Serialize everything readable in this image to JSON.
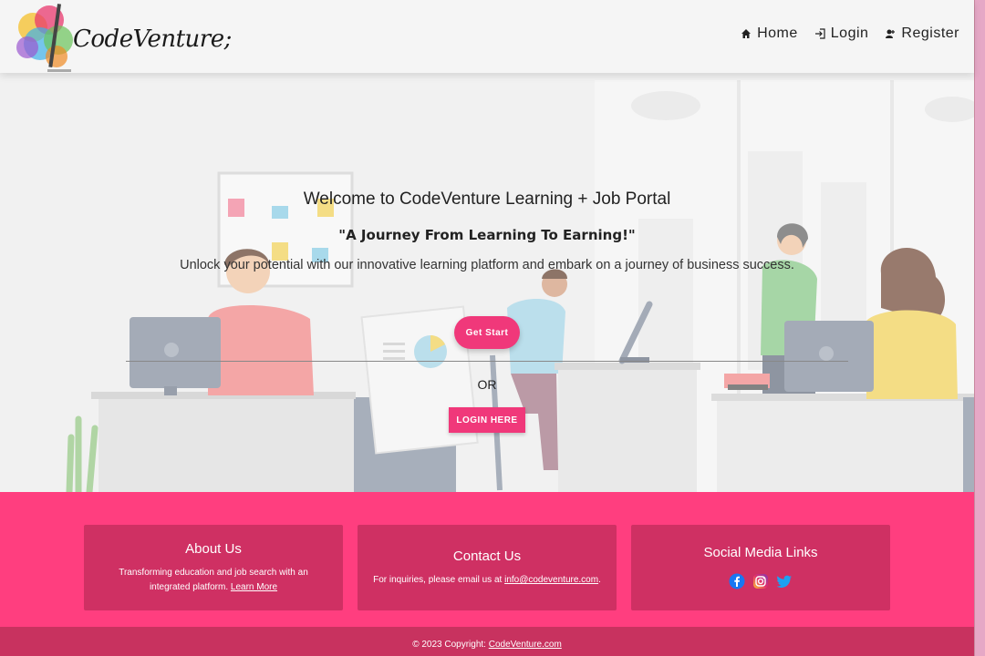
{
  "navbar": {
    "logo_text": "CodeVenture;",
    "links": [
      {
        "label": "Home",
        "icon": "home-icon"
      },
      {
        "label": "Login",
        "icon": "login-icon"
      },
      {
        "label": "Register",
        "icon": "register-icon"
      }
    ]
  },
  "hero": {
    "title": "Welcome to CodeVenture Learning + Job Portal",
    "quote": "\"A Journey From Learning To Earning!\"",
    "description": "Unlock your potential with our innovative learning platform and embark on a journey of business success.",
    "start_button": "Get Start",
    "or_text": "OR",
    "login_button": "LOGIN HERE"
  },
  "footer": {
    "about": {
      "heading": "About Us",
      "text": "Transforming education and job search with an integrated platform.",
      "link": "Learn More"
    },
    "contact": {
      "heading": "Contact Us",
      "text": "For inquiries, please email us at",
      "email": "info@codeventure.com",
      "suffix": "."
    },
    "social": {
      "heading": "Social Media Links",
      "icons": [
        "facebook-icon",
        "instagram-icon",
        "twitter-icon"
      ]
    },
    "copyright_prefix": "© 2023 Copyright:",
    "copyright_link": "CodeVenture.com"
  },
  "colors": {
    "accent": "#f0387a",
    "footer_bg": "#ff3e7f",
    "card_bg": "#cf3063",
    "copyright_bg": "#c8325f"
  }
}
